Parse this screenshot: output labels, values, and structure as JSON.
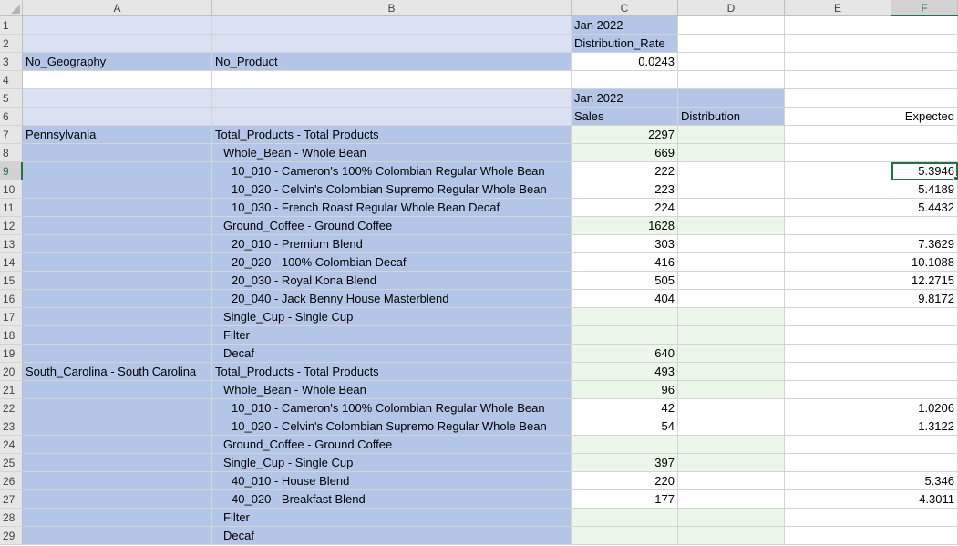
{
  "columns": [
    "A",
    "B",
    "C",
    "D",
    "E",
    "F"
  ],
  "selected_column": "F",
  "selected_row": 9,
  "rows": [
    {
      "n": 1,
      "a": "",
      "b": "",
      "c": "Jan 2022",
      "d": "",
      "e": "",
      "f": "",
      "style": "hdr1"
    },
    {
      "n": 2,
      "a": "",
      "b": "",
      "c": "Distribution_Rate",
      "d": "",
      "e": "",
      "f": "",
      "style": "hdr1"
    },
    {
      "n": 3,
      "a": "No_Geography",
      "b": "No_Product",
      "c": "0.0243",
      "d": "",
      "e": "",
      "f": "",
      "style": "pov"
    },
    {
      "n": 4,
      "a": "",
      "b": "",
      "c": "",
      "d": "",
      "e": "",
      "f": "",
      "style": "blank"
    },
    {
      "n": 5,
      "a": "",
      "b": "",
      "c": "Jan 2022",
      "d": "",
      "e": "",
      "f": "",
      "style": "hdr2"
    },
    {
      "n": 6,
      "a": "",
      "b": "",
      "c": "Sales",
      "d": "Distribution",
      "e": "",
      "f": "Expected",
      "style": "hdr2"
    },
    {
      "n": 7,
      "a": "Pennsylvania",
      "b": "Total_Products - Total Products",
      "c": "2297",
      "d": "",
      "e": "",
      "f": "",
      "style": "data",
      "lvl": 0,
      "cg": true
    },
    {
      "n": 8,
      "a": "",
      "b": "Whole_Bean - Whole Bean",
      "c": "669",
      "d": "",
      "e": "",
      "f": "",
      "style": "data",
      "lvl": 1,
      "cg": true
    },
    {
      "n": 9,
      "a": "",
      "b": "10_010 - Cameron's 100% Colombian Regular Whole Bean",
      "c": "222",
      "d": "",
      "e": "",
      "f": "5.3946",
      "style": "data",
      "lvl": 2,
      "cg": false
    },
    {
      "n": 10,
      "a": "",
      "b": "10_020 - Celvin's Colombian Supremo Regular Whole Bean",
      "c": "223",
      "d": "",
      "e": "",
      "f": "5.4189",
      "style": "data",
      "lvl": 2,
      "cg": false
    },
    {
      "n": 11,
      "a": "",
      "b": "10_030 - French Roast Regular Whole Bean Decaf",
      "c": "224",
      "d": "",
      "e": "",
      "f": "5.4432",
      "style": "data",
      "lvl": 2,
      "cg": false
    },
    {
      "n": 12,
      "a": "",
      "b": "Ground_Coffee - Ground Coffee",
      "c": "1628",
      "d": "",
      "e": "",
      "f": "",
      "style": "data",
      "lvl": 1,
      "cg": true
    },
    {
      "n": 13,
      "a": "",
      "b": "20_010 - Premium Blend",
      "c": "303",
      "d": "",
      "e": "",
      "f": "7.3629",
      "style": "data",
      "lvl": 2,
      "cg": false
    },
    {
      "n": 14,
      "a": "",
      "b": "20_020 - 100% Colombian Decaf",
      "c": "416",
      "d": "",
      "e": "",
      "f": "10.1088",
      "style": "data",
      "lvl": 2,
      "cg": false
    },
    {
      "n": 15,
      "a": "",
      "b": "20_030 - Royal Kona Blend",
      "c": "505",
      "d": "",
      "e": "",
      "f": "12.2715",
      "style": "data",
      "lvl": 2,
      "cg": false
    },
    {
      "n": 16,
      "a": "",
      "b": "20_040 - Jack Benny House Masterblend",
      "c": "404",
      "d": "",
      "e": "",
      "f": "9.8172",
      "style": "data",
      "lvl": 2,
      "cg": false
    },
    {
      "n": 17,
      "a": "",
      "b": "Single_Cup - Single Cup",
      "c": "",
      "d": "",
      "e": "",
      "f": "",
      "style": "data",
      "lvl": 1,
      "cg": true
    },
    {
      "n": 18,
      "a": "",
      "b": "Filter",
      "c": "",
      "d": "",
      "e": "",
      "f": "",
      "style": "data",
      "lvl": 1,
      "cg": true
    },
    {
      "n": 19,
      "a": "",
      "b": "Decaf",
      "c": "640",
      "d": "",
      "e": "",
      "f": "",
      "style": "data",
      "lvl": 1,
      "cg": true
    },
    {
      "n": 20,
      "a": "South_Carolina - South Carolina",
      "b": "Total_Products - Total Products",
      "c": "493",
      "d": "",
      "e": "",
      "f": "",
      "style": "data",
      "lvl": 0,
      "cg": true
    },
    {
      "n": 21,
      "a": "",
      "b": "Whole_Bean - Whole Bean",
      "c": "96",
      "d": "",
      "e": "",
      "f": "",
      "style": "data",
      "lvl": 1,
      "cg": true
    },
    {
      "n": 22,
      "a": "",
      "b": "10_010 - Cameron's 100% Colombian Regular Whole Bean",
      "c": "42",
      "d": "",
      "e": "",
      "f": "1.0206",
      "style": "data",
      "lvl": 2,
      "cg": false
    },
    {
      "n": 23,
      "a": "",
      "b": "10_020 - Celvin's Colombian Supremo Regular Whole Bean",
      "c": "54",
      "d": "",
      "e": "",
      "f": "1.3122",
      "style": "data",
      "lvl": 2,
      "cg": false
    },
    {
      "n": 24,
      "a": "",
      "b": "Ground_Coffee - Ground Coffee",
      "c": "",
      "d": "",
      "e": "",
      "f": "",
      "style": "data",
      "lvl": 1,
      "cg": true
    },
    {
      "n": 25,
      "a": "",
      "b": "Single_Cup - Single Cup",
      "c": "397",
      "d": "",
      "e": "",
      "f": "",
      "style": "data",
      "lvl": 1,
      "cg": true
    },
    {
      "n": 26,
      "a": "",
      "b": "40_010 - House Blend",
      "c": "220",
      "d": "",
      "e": "",
      "f": "5.346",
      "style": "data",
      "lvl": 2,
      "cg": false
    },
    {
      "n": 27,
      "a": "",
      "b": "40_020 - Breakfast Blend",
      "c": "177",
      "d": "",
      "e": "",
      "f": "4.3011",
      "style": "data",
      "lvl": 2,
      "cg": false
    },
    {
      "n": 28,
      "a": "",
      "b": "Filter",
      "c": "",
      "d": "",
      "e": "",
      "f": "",
      "style": "data",
      "lvl": 1,
      "cg": true
    },
    {
      "n": 29,
      "a": "",
      "b": "Decaf",
      "c": "",
      "d": "",
      "e": "",
      "f": "",
      "style": "data",
      "lvl": 1,
      "cg": true
    }
  ],
  "colors": {
    "header_light": "#d9e1f2",
    "header_mid": "#b4c6e7",
    "member": "#b4c6e7",
    "green_cell": "#ebf7e8",
    "selection": "#217346"
  }
}
